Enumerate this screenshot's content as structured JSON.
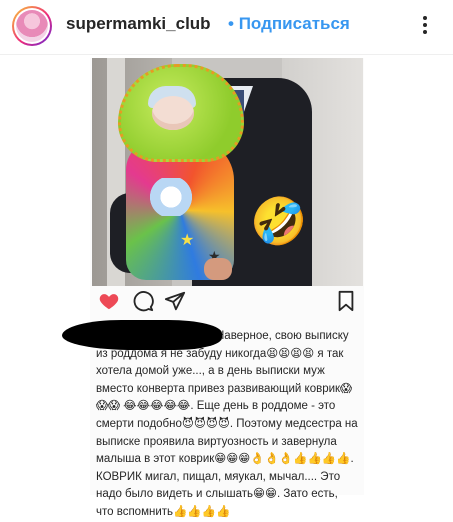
{
  "header": {
    "username": "supermamki_club",
    "separator": "•",
    "follow_label": "Подписаться",
    "more_icon": "more-vertical-icon"
  },
  "post": {
    "overlay_emoji": "🤣",
    "actions": {
      "like_icon": "heart-icon",
      "comment_icon": "comment-icon",
      "share_icon": "share-icon",
      "save_icon": "bookmark-icon",
      "like_color": "#ed4956"
    },
    "caption": "Наверное, свою выписку из роддома я не забуду никогда😫😫😫😫 я так хотела домой уже..., а в день выписки муж вместо конверта привез развивающий коврик😱😱😱 😂😂😂😂😂. Еще день в роддоме - это смерти подобно😈😈😈😈. Поэтому медсестра на выписке проявила виртуозность и завернула малыша в этот коврик😁😁😁👌👌👌👍👍👍👍. КОВРИК мигал, пищал, мяукал, мычал.... Это надо было видеть и слышать😁😁. Зато есть, что вспомнить👍👍👍👍"
  },
  "colors": {
    "brand_link": "#3897f0",
    "text": "#262626"
  }
}
